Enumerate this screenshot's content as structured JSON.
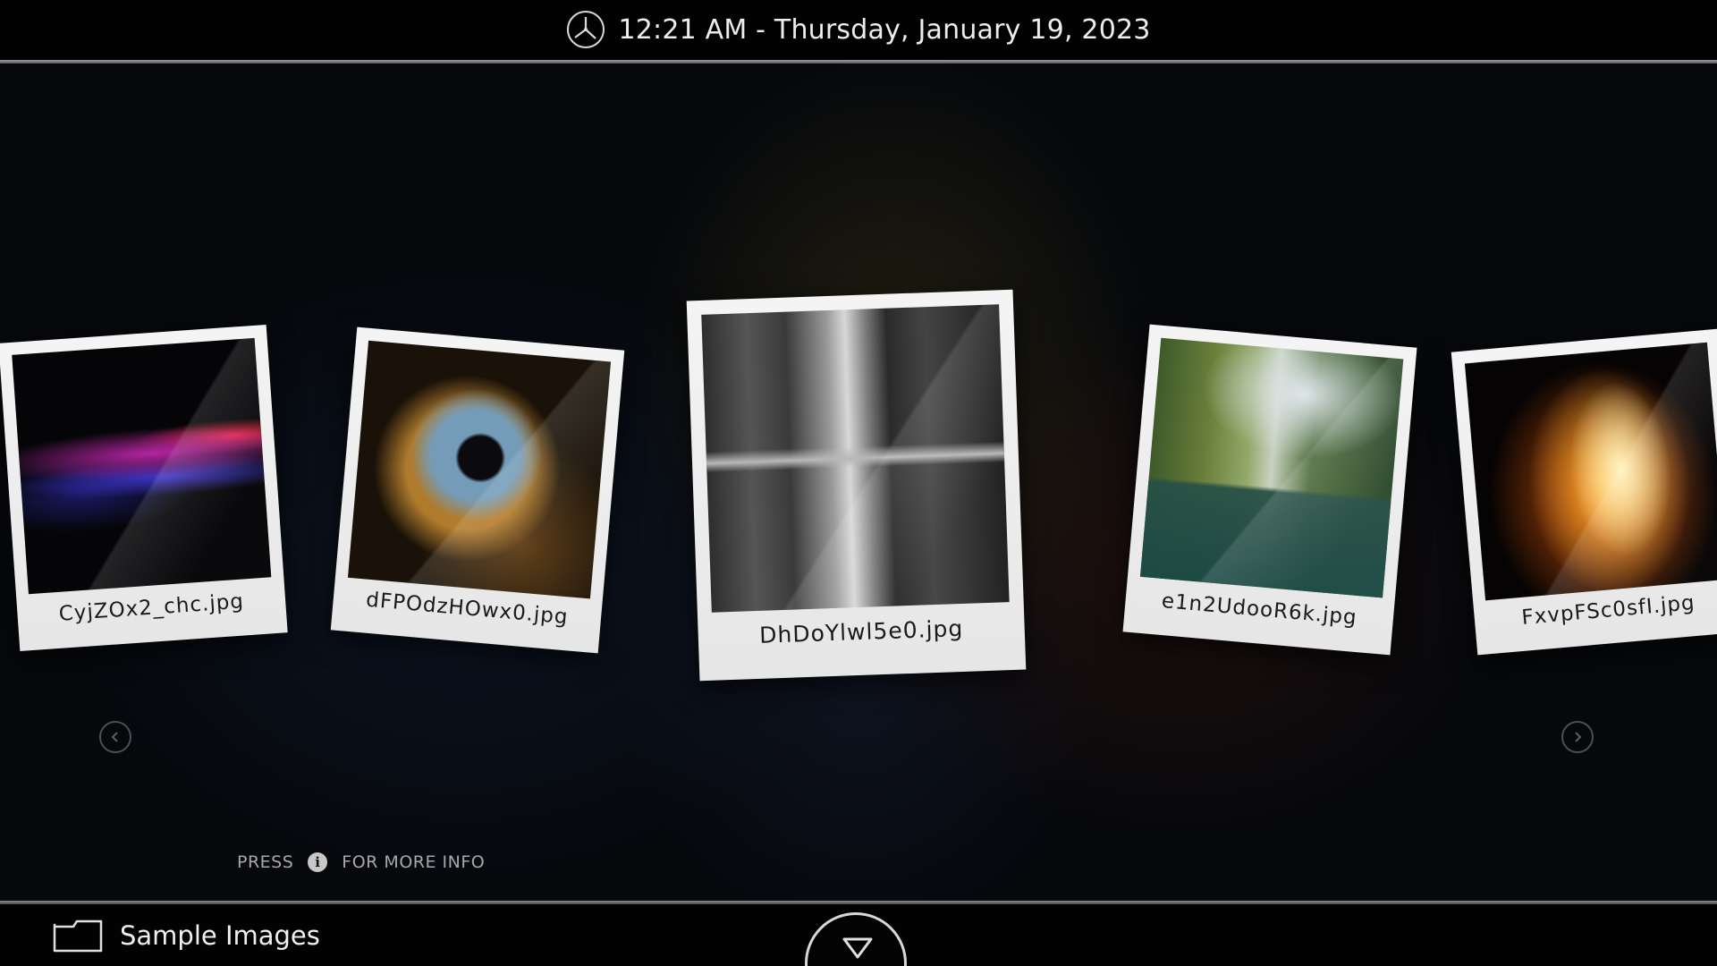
{
  "header": {
    "datetime": "12:21 AM - Thursday, January 19, 2023",
    "clock_icon": "clock-icon"
  },
  "carousel": {
    "items": [
      {
        "filename": "CyjZOx2_chc.jpg"
      },
      {
        "filename": "dFPOdzHOwx0.jpg"
      },
      {
        "filename": "DhDoYlwl5e0.jpg"
      },
      {
        "filename": "e1n2UdooR6k.jpg"
      },
      {
        "filename": "FxvpFSc0sfI.jpg"
      }
    ],
    "prev_icon": "chevron-left-icon",
    "next_icon": "chevron-right-icon"
  },
  "hint": {
    "press": "PRESS",
    "info_icon_glyph": "i",
    "more": "FOR MORE INFO"
  },
  "footer": {
    "folder_label": "Sample Images",
    "folder_icon": "folder-icon",
    "menu_icon": "triangle-down-icon"
  },
  "colors": {
    "bar_background": "#020203",
    "bar_divider": "#8a8a8a",
    "polaroid_frame": "#f0f0f0",
    "caption_text": "#1a1a1a"
  }
}
